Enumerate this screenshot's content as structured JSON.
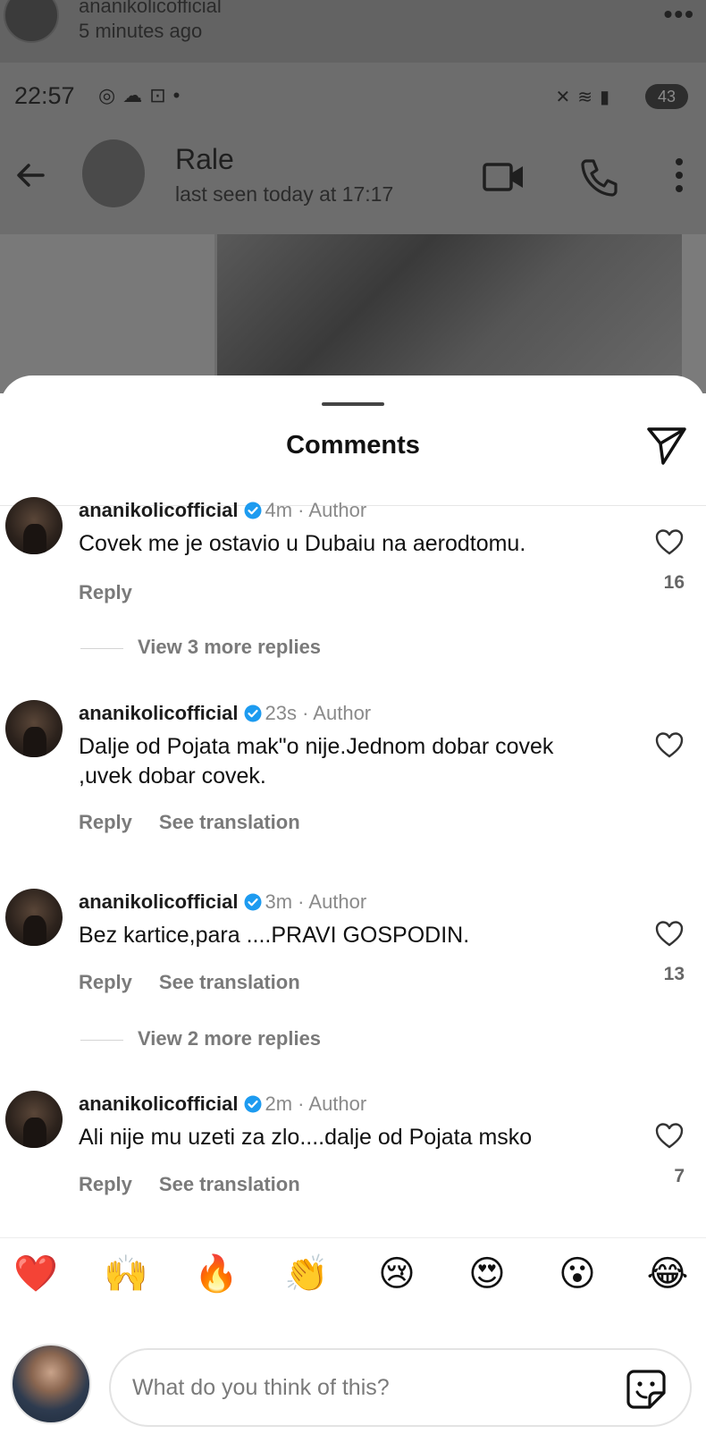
{
  "background": {
    "post_username": "ananikolicofficial",
    "post_time": "5 minutes ago",
    "status_time": "22:57",
    "battery": "43",
    "chat_name": "Rale",
    "chat_last_seen": "last seen today at 17:17"
  },
  "sheet": {
    "title": "Comments"
  },
  "comments": [
    {
      "username": "ananikolicofficial",
      "meta": "4m · Author",
      "text": "Covek me je ostavio u Dubaiu na aerodtomu.",
      "reply": "Reply",
      "likes": "16",
      "view_more": "View 3 more replies"
    },
    {
      "username": "ananikolicofficial",
      "meta": "23s · Author",
      "text": "Dalje od Pojata mak\"o nije.Jednom dobar covek ,uvek dobar covek.",
      "reply": "Reply",
      "see_translation": "See translation"
    },
    {
      "username": "ananikolicofficial",
      "meta": "3m · Author",
      "text": "Bez kartice,para ....PRAVI GOSPODIN.",
      "reply": "Reply",
      "see_translation": "See translation",
      "likes": "13",
      "view_more": "View 2 more replies"
    },
    {
      "username": "ananikolicofficial",
      "meta": "2m · Author",
      "text": "Ali nije mu uzeti za zlo....dalje od Pojata msko",
      "reply": "Reply",
      "see_translation": "See translation",
      "likes": "7"
    }
  ],
  "emoji_bar": [
    "❤️",
    "🙌",
    "🔥",
    "👏",
    "😢",
    "😍",
    "😮",
    "😂"
  ],
  "composer": {
    "placeholder": "What do you think of this?"
  },
  "colors": {
    "verified": "#1d9bf0",
    "heart_red": "#ff2d3a"
  }
}
